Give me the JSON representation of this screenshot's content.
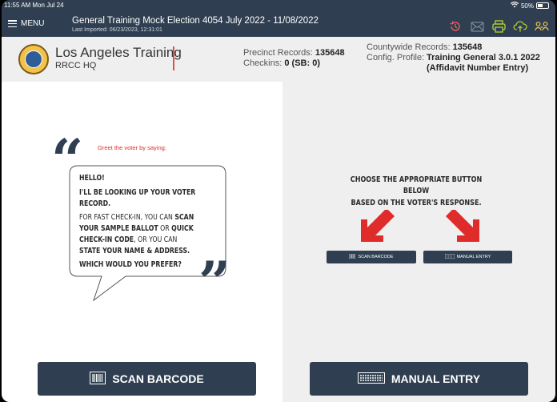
{
  "status_bar": {
    "time": "11:55 AM  Mon Jul 24",
    "battery": "50%"
  },
  "header": {
    "menu_label": "MENU",
    "election_title": "General Training Mock Election 4054  July 2022  - 11/08/2022",
    "last_imported": "Last Imported: 06/23/2023, 12:31:01"
  },
  "top_icons": [
    "history-icon",
    "mail-icon",
    "printer-icon",
    "cloud-upload-icon",
    "user-switch-icon"
  ],
  "info": {
    "org_name": "Los Angeles Training",
    "org_sub": "RRCC HQ",
    "precinct_label": "Precinct Records:",
    "precinct_value": "135648",
    "checkins_label": "Checkins:",
    "checkins_value": "0 (SB: 0)",
    "countywide_label": "Countywide Records:",
    "countywide_value": "135648",
    "config_label": "Config. Profile:",
    "config_value_line1": "Training General 3.0.1 2022",
    "config_value_line2": "(Affidavit Number Entry)"
  },
  "left_pane": {
    "greet": "Greet the voter by saying:",
    "line1": "Hello!",
    "line2": "I'll be looking up your voter record.",
    "line3a": "For fast check-in, you can ",
    "line3b": "scan your sample ballot",
    "line3c": " or ",
    "line3d": "quick check-in code",
    "line3e": ", or you can ",
    "line3f": "state your name & address.",
    "line4": "Which would you prefer?"
  },
  "right_pane": {
    "instruction_line1": "Choose the appropriate button below",
    "instruction_line2": "based on the voter's response.",
    "mini_scan_label": "SCAN BARCODE",
    "mini_manual_label": "MANUAL ENTRY"
  },
  "buttons": {
    "scan_barcode": "SCAN BARCODE",
    "manual_entry": "MANUAL ENTRY"
  },
  "colors": {
    "navy": "#2f3f51",
    "accent_red": "#e02b2b",
    "icon_green": "#b5d334",
    "icon_red": "#f25a5a"
  }
}
